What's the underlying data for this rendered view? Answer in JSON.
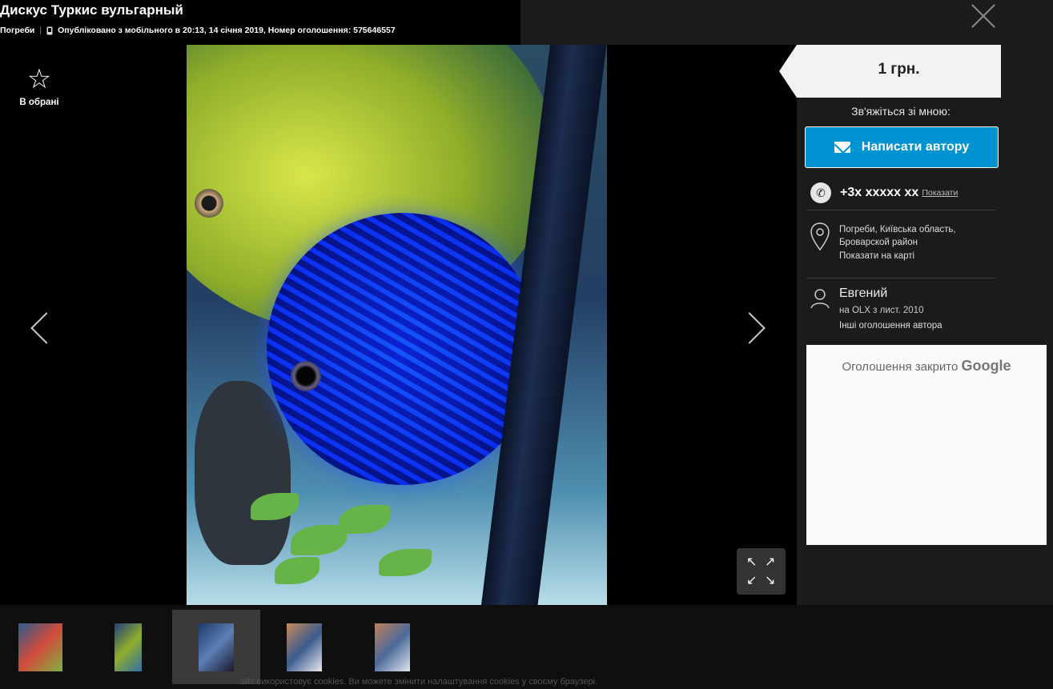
{
  "header": {
    "title": "Дискус Туркис вульгарный",
    "location": "Погреби",
    "separator": "|",
    "published": "Опубліковано з мобільного в 20:13, 14 січня 2019, Номер оголошення: 575646557"
  },
  "viewer": {
    "favorite_icon": "☆",
    "favorite_label": "В обрані",
    "expand_glyphs": [
      "↖",
      "↗",
      "↙",
      "↘"
    ]
  },
  "thumbnails": [
    {
      "name": "thumb-1",
      "colors": [
        "#2c5b8e",
        "#d14b3a",
        "#7fb242"
      ]
    },
    {
      "name": "thumb-2",
      "colors": [
        "#1f3f7a",
        "#8fae2a",
        "#2f6ea8"
      ]
    },
    {
      "name": "thumb-3",
      "colors": [
        "#1d3a6b",
        "#5c7fb5",
        "#1a1a2e"
      ],
      "active": true
    },
    {
      "name": "thumb-4",
      "colors": [
        "#c68a58",
        "#3b5c8e",
        "#e8e8f0"
      ]
    },
    {
      "name": "thumb-5",
      "colors": [
        "#b9815a",
        "#4e6a9a",
        "#dfe6ef"
      ]
    }
  ],
  "cookie_text": "айт використовує cookies. Ви можете змінити налаштування cookies у своєму браузері.",
  "sidebar": {
    "price": "1 грн.",
    "contact_label": "Зв'яжіться зі мною:",
    "message_button": "Написати автору",
    "phone": "+3x xxxxx xx",
    "show_phone": "Показати",
    "location_line1": "Погреби, Київська область,",
    "location_line2": "Броварской район",
    "show_on_map": "Показати на карті",
    "user_name": "Евгений",
    "user_since": "на OLX з лист. 2010",
    "other_ads": "Інші оголошення автора",
    "ad_closed": "Оголошення закрито",
    "ad_brand": "Google"
  },
  "colors": {
    "accent_button": "#0093d2",
    "panel_bg": "#1b1b1b",
    "price_box_bg": "#f2f2f2"
  }
}
